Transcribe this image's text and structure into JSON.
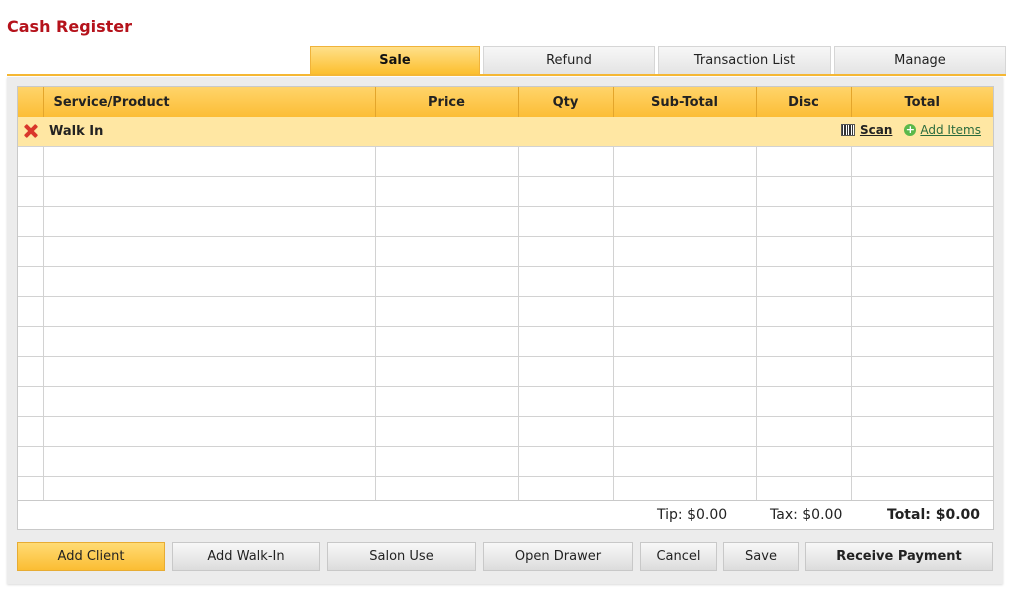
{
  "header": {
    "title": "Cash Register"
  },
  "tabs": [
    {
      "label": "Sale",
      "active": true
    },
    {
      "label": "Refund",
      "active": false
    },
    {
      "label": "Transaction List",
      "active": false
    },
    {
      "label": "Manage",
      "active": false
    }
  ],
  "table": {
    "columns": [
      "Service/Product",
      "Price",
      "Qty",
      "Sub-Total",
      "Disc",
      "Total"
    ],
    "client_row": {
      "name": "Walk In",
      "scan_label": "Scan",
      "add_items_label": "Add Items"
    },
    "empty_rows": 12
  },
  "totals": {
    "tip": "Tip: $0.00",
    "tax": "Tax: $0.00",
    "total": "Total: $0.00"
  },
  "actions": {
    "add_client": "Add Client",
    "add_walk_in": "Add Walk-In",
    "salon_use": "Salon Use",
    "open_drawer": "Open Drawer",
    "cancel": "Cancel",
    "save": "Save",
    "receive_payment": "Receive Payment"
  },
  "colors": {
    "title": "#b5121b",
    "accent": "#fcbd35",
    "client_row": "#ffe7a3"
  },
  "icons": [
    "remove-icon",
    "barcode-icon",
    "plus-icon"
  ]
}
